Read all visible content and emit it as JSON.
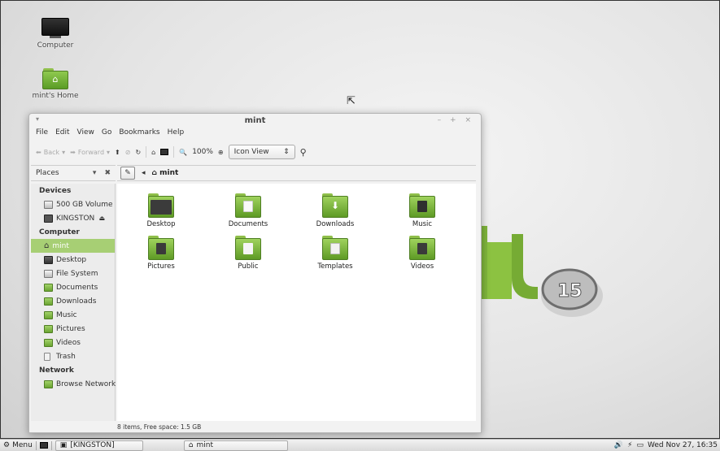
{
  "desktop": {
    "icons": [
      {
        "label": "Computer"
      },
      {
        "label": "mint's Home"
      }
    ]
  },
  "window": {
    "title": "mint",
    "window_menu_glyph": "▾",
    "controls": [
      "–",
      "+",
      "×"
    ],
    "menu": [
      "File",
      "Edit",
      "View",
      "Go",
      "Bookmarks",
      "Help"
    ],
    "toolbar": {
      "back": "Back",
      "forward": "Forward",
      "zoom": "100%",
      "view_mode": "Icon View"
    },
    "places": {
      "label": "Places"
    },
    "path": {
      "current": "mint"
    },
    "sidebar": {
      "devices_heading": "Devices",
      "devices": [
        "500 GB Volume",
        "KINGSTON"
      ],
      "computer_heading": "Computer",
      "computer": [
        "mint",
        "Desktop",
        "File System",
        "Documents",
        "Downloads",
        "Music",
        "Pictures",
        "Videos",
        "Trash"
      ],
      "network_heading": "Network",
      "network": [
        "Browse Network"
      ]
    },
    "files": [
      "Desktop",
      "Documents",
      "Downloads",
      "Music",
      "Pictures",
      "Public",
      "Templates",
      "Videos"
    ],
    "status": "8 items, Free space: 1.5 GB"
  },
  "taskbar": {
    "menu_label": "Menu",
    "tasks": [
      "[KINGSTON]",
      "mint"
    ],
    "clock": "Wed Nov 27, 16:35"
  },
  "colors": {
    "accent_green": "#a7cf74",
    "folder_green": "#6aa431"
  }
}
